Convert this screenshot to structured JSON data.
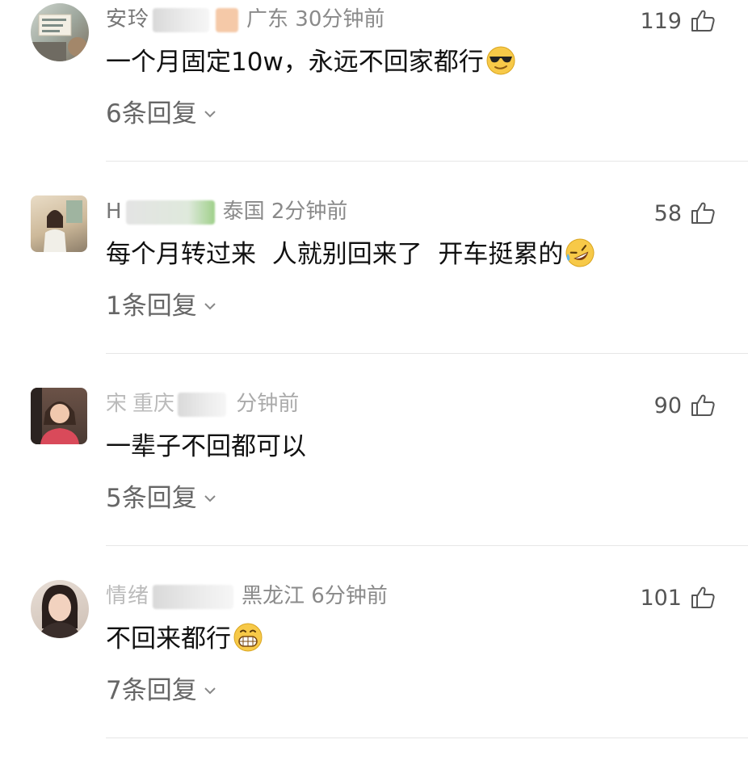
{
  "comments": [
    {
      "username": "安玲",
      "location": "广东",
      "time": "30分钟前",
      "likes": "119",
      "text": "一个月固定10w，永远不回家都行",
      "emoji": "sunglasses-emoji",
      "replies": "6条回复"
    },
    {
      "username": "H",
      "location": "泰国",
      "time": "2分钟前",
      "likes": "58",
      "text": "每个月转过来  人就别回来了  开车挺累的",
      "emoji": "rolling-laughing-emoji",
      "replies": "1条回复"
    },
    {
      "username": "宋",
      "location": "重庆",
      "time": "分钟前",
      "likes": "90",
      "text": "一辈子不回都可以",
      "emoji": "",
      "replies": "5条回复"
    },
    {
      "username": "情绪",
      "location": "黑龙江",
      "time": "6分钟前",
      "likes": "101",
      "text": "不回来都行",
      "emoji": "grinning-emoji",
      "replies": "7条回复"
    }
  ],
  "icons": {
    "like": "thumbs-up-icon",
    "expand": "chevron-down-icon"
  },
  "colors": {
    "meta": "#8a8a8a",
    "divider": "#e6e6e6",
    "emoji_yellow": "#f7c948"
  }
}
